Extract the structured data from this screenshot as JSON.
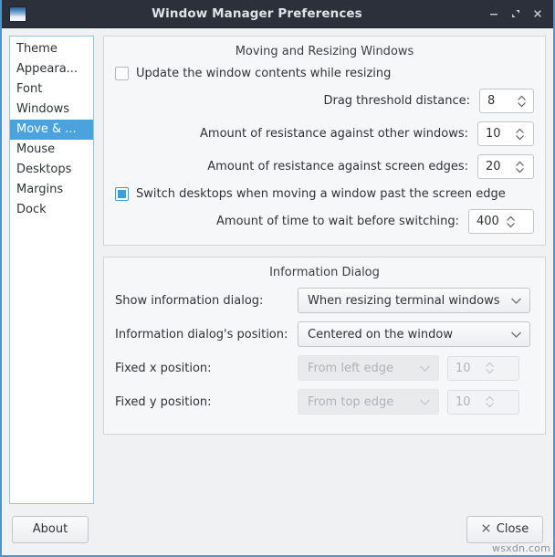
{
  "window": {
    "title": "Window Manager Preferences",
    "icon": "window-icon",
    "controls": [
      {
        "name": "minimize-button",
        "glyph": "minimize-icon"
      },
      {
        "name": "maximize-button",
        "glyph": "maximize-icon"
      },
      {
        "name": "close-button",
        "glyph": "close-icon"
      }
    ],
    "accent_color": "#4aa3dc",
    "titlebar_color": "#2b303b"
  },
  "sidebar": {
    "items": [
      {
        "label": "Theme",
        "selected": false
      },
      {
        "label": "Appeara...",
        "selected": false
      },
      {
        "label": "Font",
        "selected": false
      },
      {
        "label": "Windows",
        "selected": false
      },
      {
        "label": "Move & ...",
        "selected": true
      },
      {
        "label": "Mouse",
        "selected": false
      },
      {
        "label": "Desktops",
        "selected": false
      },
      {
        "label": "Margins",
        "selected": false
      },
      {
        "label": "Dock",
        "selected": false
      }
    ]
  },
  "moving_group": {
    "title": "Moving and Resizing Windows",
    "update_contents": {
      "label": "Update the window contents while resizing",
      "checked": false
    },
    "drag_threshold": {
      "label": "Drag threshold distance:",
      "value": "8"
    },
    "resistance_windows": {
      "label": "Amount of resistance against other windows:",
      "value": "10"
    },
    "resistance_edges": {
      "label": "Amount of resistance against screen edges:",
      "value": "20"
    },
    "switch_desktops": {
      "label": "Switch desktops when moving a window past the screen edge",
      "checked": true
    },
    "wait_time": {
      "label": "Amount of time to wait before switching:",
      "value": "400"
    }
  },
  "info_group": {
    "title": "Information Dialog",
    "show_dialog": {
      "label": "Show information dialog:",
      "value": "When resizing terminal windows",
      "disabled": false
    },
    "dialog_position": {
      "label": "Information dialog's position:",
      "value": "Centered on the window",
      "disabled": false
    },
    "fixed_x": {
      "label": "Fixed x position:",
      "anchor": "From left edge",
      "value": "10",
      "disabled": true
    },
    "fixed_y": {
      "label": "Fixed y position:",
      "anchor": "From top edge",
      "value": "10",
      "disabled": true
    }
  },
  "footer": {
    "about_label": "About",
    "close_label": "Close",
    "close_icon": "x-icon"
  },
  "watermark": "wsxdn.com"
}
